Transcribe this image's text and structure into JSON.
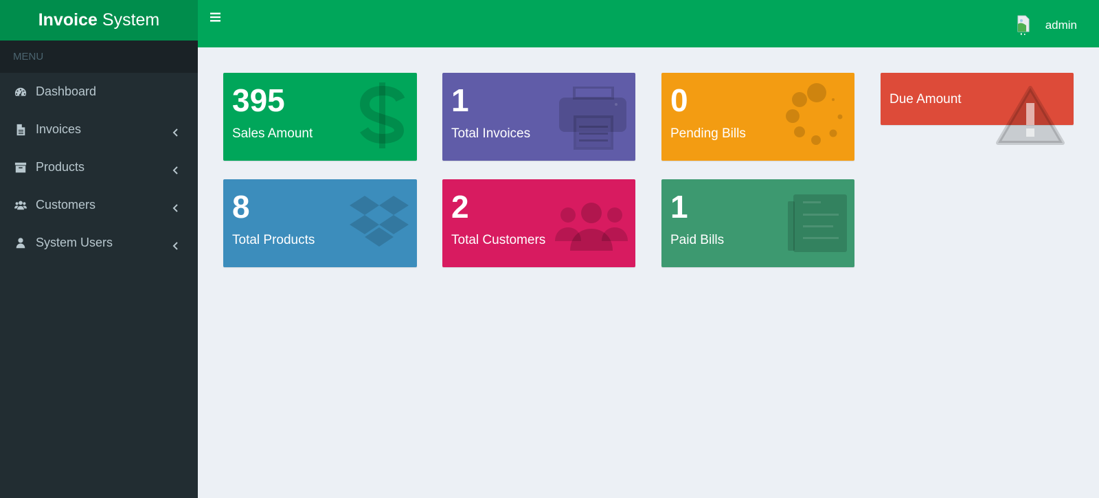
{
  "brand": {
    "bold": "Invoice",
    "rest": "System"
  },
  "menu_header": "MENU",
  "sidebar": {
    "items": [
      {
        "label": "Dashboard",
        "icon": "dashboard-icon",
        "has_submenu": false
      },
      {
        "label": "Invoices",
        "icon": "file-icon",
        "has_submenu": true
      },
      {
        "label": "Products",
        "icon": "archive-icon",
        "has_submenu": true
      },
      {
        "label": "Customers",
        "icon": "users-icon",
        "has_submenu": true
      },
      {
        "label": "System Users",
        "icon": "user-icon",
        "has_submenu": true
      }
    ]
  },
  "topbar": {
    "user_name": "admin",
    "toggle_icon": "hamburger-icon"
  },
  "boxes": {
    "sales": {
      "value": "395",
      "label": "Sales Amount",
      "color": "#00a65a",
      "icon": "dollar-icon"
    },
    "invoices": {
      "value": "1",
      "label": "Total Invoices",
      "color": "#605ca8",
      "icon": "printer-icon"
    },
    "pending": {
      "value": "0",
      "label": "Pending Bills",
      "color": "#f39c12",
      "icon": "spinner-icon"
    },
    "due": {
      "value": "",
      "label": "Due Amount",
      "color": "#dd4b39",
      "icon": "warning-icon"
    },
    "products": {
      "value": "8",
      "label": "Total Products",
      "color": "#3c8dbc",
      "icon": "dropbox-icon"
    },
    "customers": {
      "value": "2",
      "label": "Total Customers",
      "color": "#d81b60",
      "icon": "users-group-icon"
    },
    "paid": {
      "value": "1",
      "label": "Paid Bills",
      "color": "#3d9970",
      "icon": "newspaper-icon"
    }
  }
}
